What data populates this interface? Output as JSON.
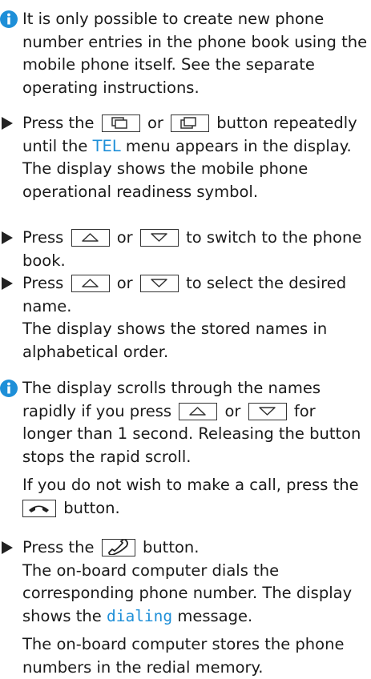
{
  "accent_color": "#1e8fd8",
  "icons": {
    "info": "info-icon",
    "bullet": "arrow-bullet-icon",
    "page_back": "page-back-icon",
    "page_forward": "page-forward-icon",
    "up": "up-arrow-key-icon",
    "down": "down-arrow-key-icon",
    "end_call": "end-call-icon",
    "make_call": "make-call-icon"
  },
  "note1": {
    "text": "It is only possible to create new phone number entries in the phone book using the mobile phone itself. See the separate operating instructions."
  },
  "step1": {
    "t1": "Press the",
    "or": "or",
    "t2": "button repeatedly until the",
    "menu": "TEL",
    "t3": "menu appears in the display.",
    "result": "The display shows the mobile phone operational readiness symbol."
  },
  "step2": {
    "t1": "Press",
    "or": "or",
    "t2": "to switch to the phone book."
  },
  "step3": {
    "t1": "Press",
    "or": "or",
    "t2": "to select the desired name.",
    "result": "The display shows the stored names in alphabetical order."
  },
  "note2": {
    "t1": "The display scrolls through the names rapidly if you press",
    "or": "or",
    "t2": "for longer than 1 second. Releasing the button stops the rapid scroll.",
    "p2a": "If you do not wish to make a call, press the",
    "p2b": "button."
  },
  "step4": {
    "t1": "Press the",
    "t2": "button.",
    "result1a": "The on-board computer dials the corresponding phone number. The display shows the",
    "message": "dialing",
    "result1b": "message.",
    "result2": "The on-board computer stores the phone numbers in the redial memory."
  }
}
